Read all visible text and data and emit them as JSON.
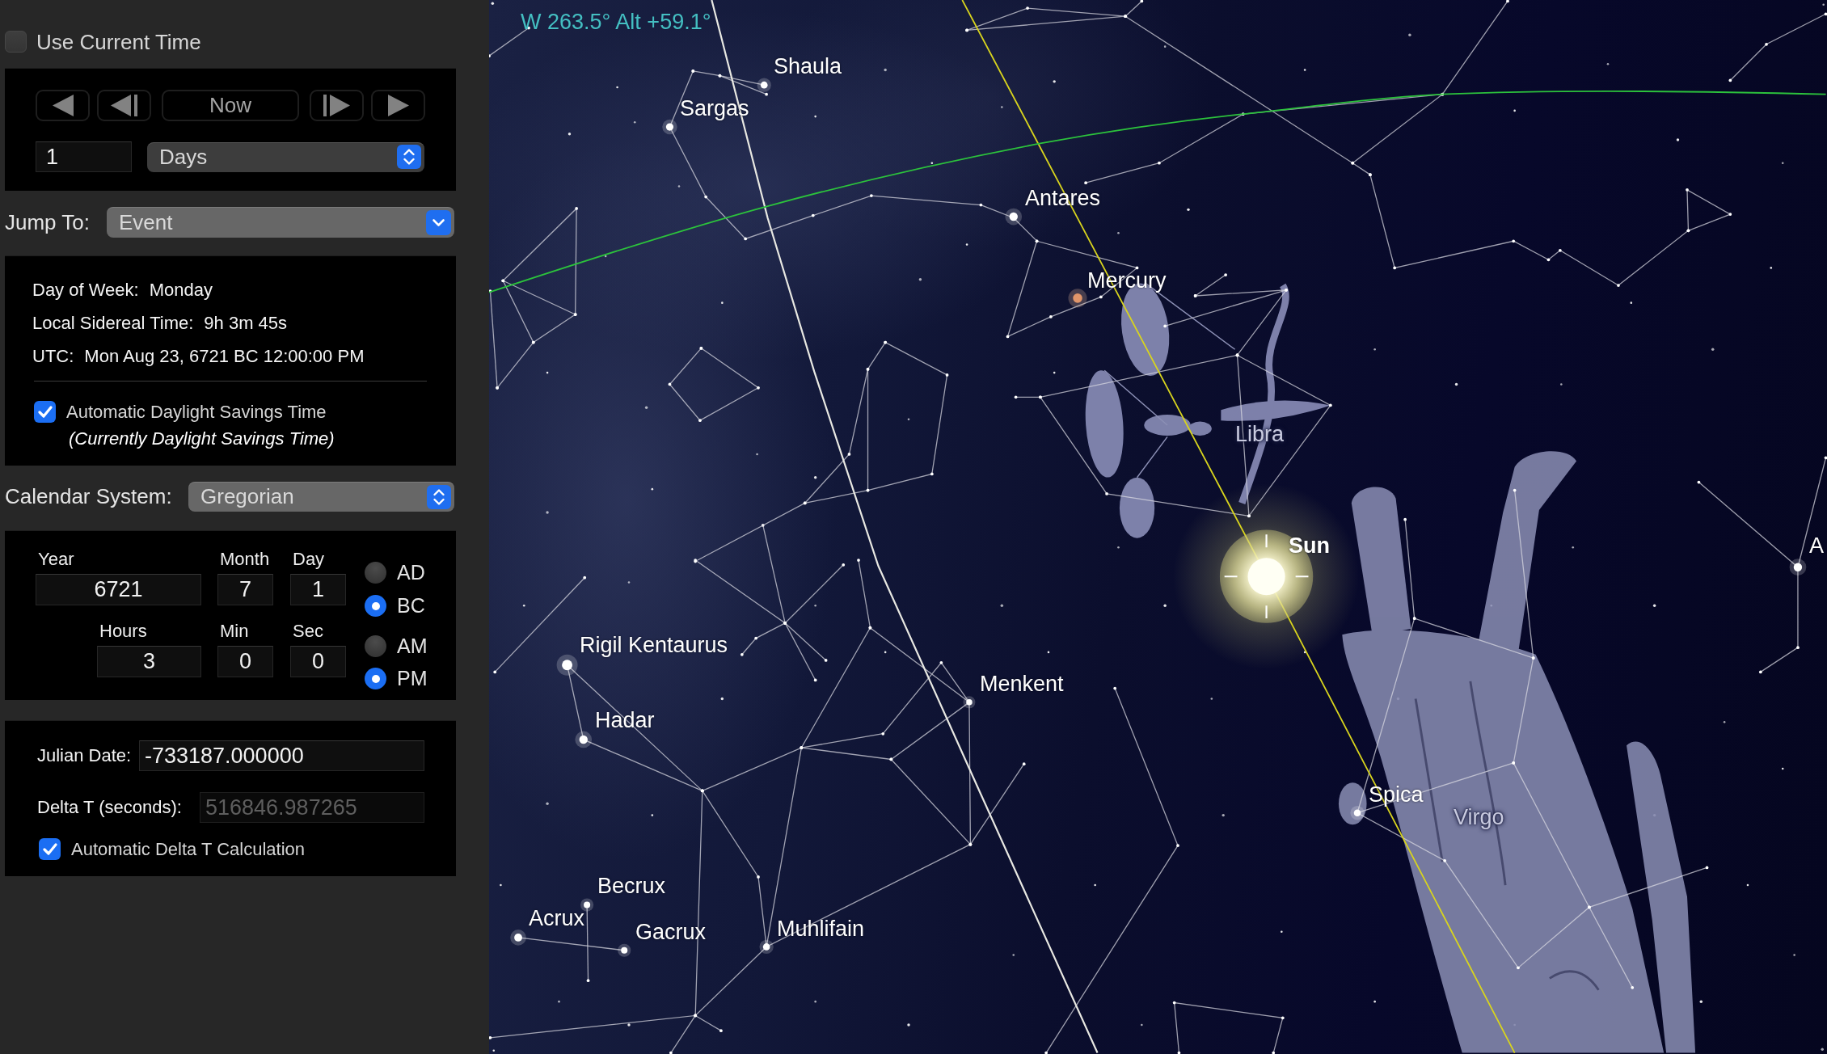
{
  "time_panel": {
    "use_current_time": {
      "label": "Use Current Time",
      "checked": false
    },
    "stepper": {
      "buttons": [
        {
          "kind": "back"
        },
        {
          "kind": "step_back"
        },
        {
          "kind": "now",
          "label": "Now"
        },
        {
          "kind": "step_forward"
        },
        {
          "kind": "forward"
        }
      ],
      "amount": "1",
      "unit": "Days"
    },
    "jump_to": {
      "label": "Jump To:",
      "value": "Event"
    },
    "info": {
      "lines": [
        {
          "label": "Day of Week:",
          "value": "Monday"
        },
        {
          "label": "Local Sidereal Time:",
          "value": "9h 3m 45s"
        },
        {
          "label": "UTC:",
          "value": "Mon Aug 23, 6721 BC 12:00:00 PM"
        }
      ],
      "auto_dst": {
        "label": "Automatic Daylight Savings Time",
        "checked": true
      },
      "dst_note": "(Currently Daylight Savings Time)"
    },
    "calendar_system": {
      "label": "Calendar System:",
      "value": "Gregorian"
    },
    "date_time": {
      "date_fields": [
        {
          "label": "Year",
          "value": "6721"
        },
        {
          "label": "Month",
          "value": "7"
        },
        {
          "label": "Day",
          "value": "1"
        }
      ],
      "time_fields": [
        {
          "label": "Hours",
          "value": "3"
        },
        {
          "label": "Min",
          "value": "0"
        },
        {
          "label": "Sec",
          "value": "0"
        }
      ],
      "era": [
        {
          "label": "AD",
          "selected": false
        },
        {
          "label": "BC",
          "selected": true
        }
      ],
      "meridiem": [
        {
          "label": "AM",
          "selected": false
        },
        {
          "label": "PM",
          "selected": true
        }
      ]
    },
    "julian": {
      "julian_date": {
        "label": "Julian Date:",
        "value": "-733187.000000",
        "disabled": false
      },
      "delta_t": {
        "label": "Delta T (seconds):",
        "value": "516846.987265",
        "disabled": true
      },
      "auto_delta_t": {
        "label": "Automatic Delta T Calculation",
        "checked": true
      }
    }
  },
  "sky_view": {
    "readout": "W 263.5° Alt +59.1°",
    "labels": [
      {
        "text": "Shaula",
        "kind": "star"
      },
      {
        "text": "Sargas",
        "kind": "star"
      },
      {
        "text": "Antares",
        "kind": "star"
      },
      {
        "text": "Mercury",
        "kind": "planet"
      },
      {
        "text": "Libra",
        "kind": "constellation"
      },
      {
        "text": "Sun",
        "kind": "sun"
      },
      {
        "text": "A",
        "kind": "star"
      },
      {
        "text": "Rigil Kentaurus",
        "kind": "star"
      },
      {
        "text": "Menkent",
        "kind": "star"
      },
      {
        "text": "Hadar",
        "kind": "star"
      },
      {
        "text": "Spica",
        "kind": "star"
      },
      {
        "text": "Virgo",
        "kind": "constellation"
      },
      {
        "text": "Becrux",
        "kind": "star"
      },
      {
        "text": "Acrux",
        "kind": "star"
      },
      {
        "text": "Gacrux",
        "kind": "star"
      },
      {
        "text": "Muhlifain",
        "kind": "star"
      }
    ]
  }
}
